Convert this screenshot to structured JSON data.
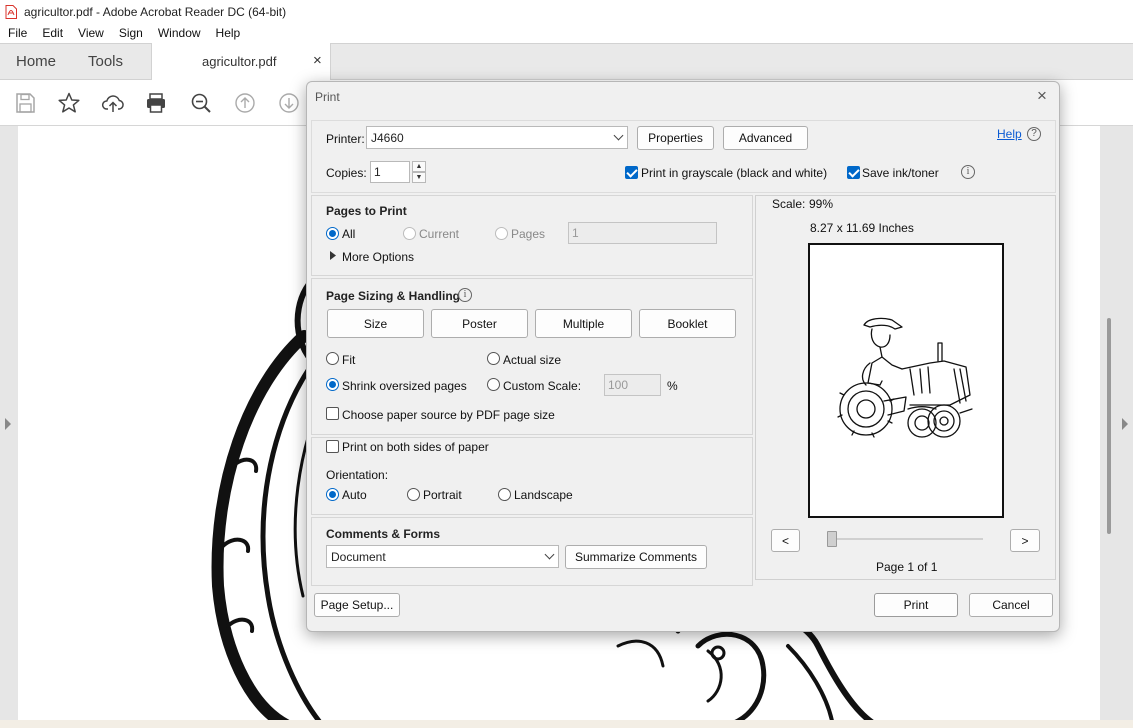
{
  "window": {
    "title": "agricultor.pdf - Adobe Acrobat Reader DC (64-bit)",
    "app_icon": "pdf-file-icon"
  },
  "menu": [
    "File",
    "Edit",
    "View",
    "Sign",
    "Window",
    "Help"
  ],
  "tabs": {
    "home": "Home",
    "tools": "Tools",
    "document": "agricultor.pdf",
    "close": "×"
  },
  "toolbar_icons": [
    "save-icon",
    "star-icon",
    "cloud-upload-icon",
    "print-icon",
    "zoom-out-icon",
    "page-up-icon",
    "page-down-icon"
  ],
  "print_dialog": {
    "title": "Print",
    "close": "×",
    "printer_label": "Printer:",
    "printer_value": "J4660",
    "properties_button": "Properties",
    "advanced_button": "Advanced",
    "help_link": "Help",
    "help_icon": "?",
    "copies_label": "Copies:",
    "copies_value": "1",
    "grayscale_label": "Print in grayscale (black and white)",
    "grayscale_checked": true,
    "save_ink_label": "Save ink/toner",
    "save_ink_checked": true,
    "info_icon": "i",
    "pages_to_print": {
      "title": "Pages to Print",
      "all": "All",
      "current": "Current",
      "pages": "Pages",
      "pages_value": "1",
      "selected": "All",
      "more_options": "More Options"
    },
    "page_sizing": {
      "title": "Page Sizing & Handling",
      "size_button": "Size",
      "poster_button": "Poster",
      "multiple_button": "Multiple",
      "booklet_button": "Booklet",
      "fit": "Fit",
      "actual_size": "Actual size",
      "shrink": "Shrink oversized pages",
      "custom_scale": "Custom Scale:",
      "custom_scale_value": "100",
      "percent": "%",
      "selected": "Shrink oversized pages",
      "paper_source": "Choose paper source by PDF page size",
      "paper_source_checked": false
    },
    "both_sides": {
      "label": "Print on both sides of paper",
      "checked": false
    },
    "orientation": {
      "title": "Orientation:",
      "auto": "Auto",
      "portrait": "Portrait",
      "landscape": "Landscape",
      "selected": "Auto"
    },
    "comments_forms": {
      "title": "Comments & Forms",
      "select_value": "Document",
      "summarize_button": "Summarize Comments"
    },
    "preview": {
      "scale_label": "Scale:",
      "scale_value": "99%",
      "dimensions": "8.27 x 11.69 Inches",
      "prev_button": "<",
      "next_button": ">",
      "page_indicator": "Page 1 of 1",
      "slider_position": 0
    },
    "page_setup_button": "Page Setup...",
    "print_button": "Print",
    "cancel_button": "Cancel"
  }
}
